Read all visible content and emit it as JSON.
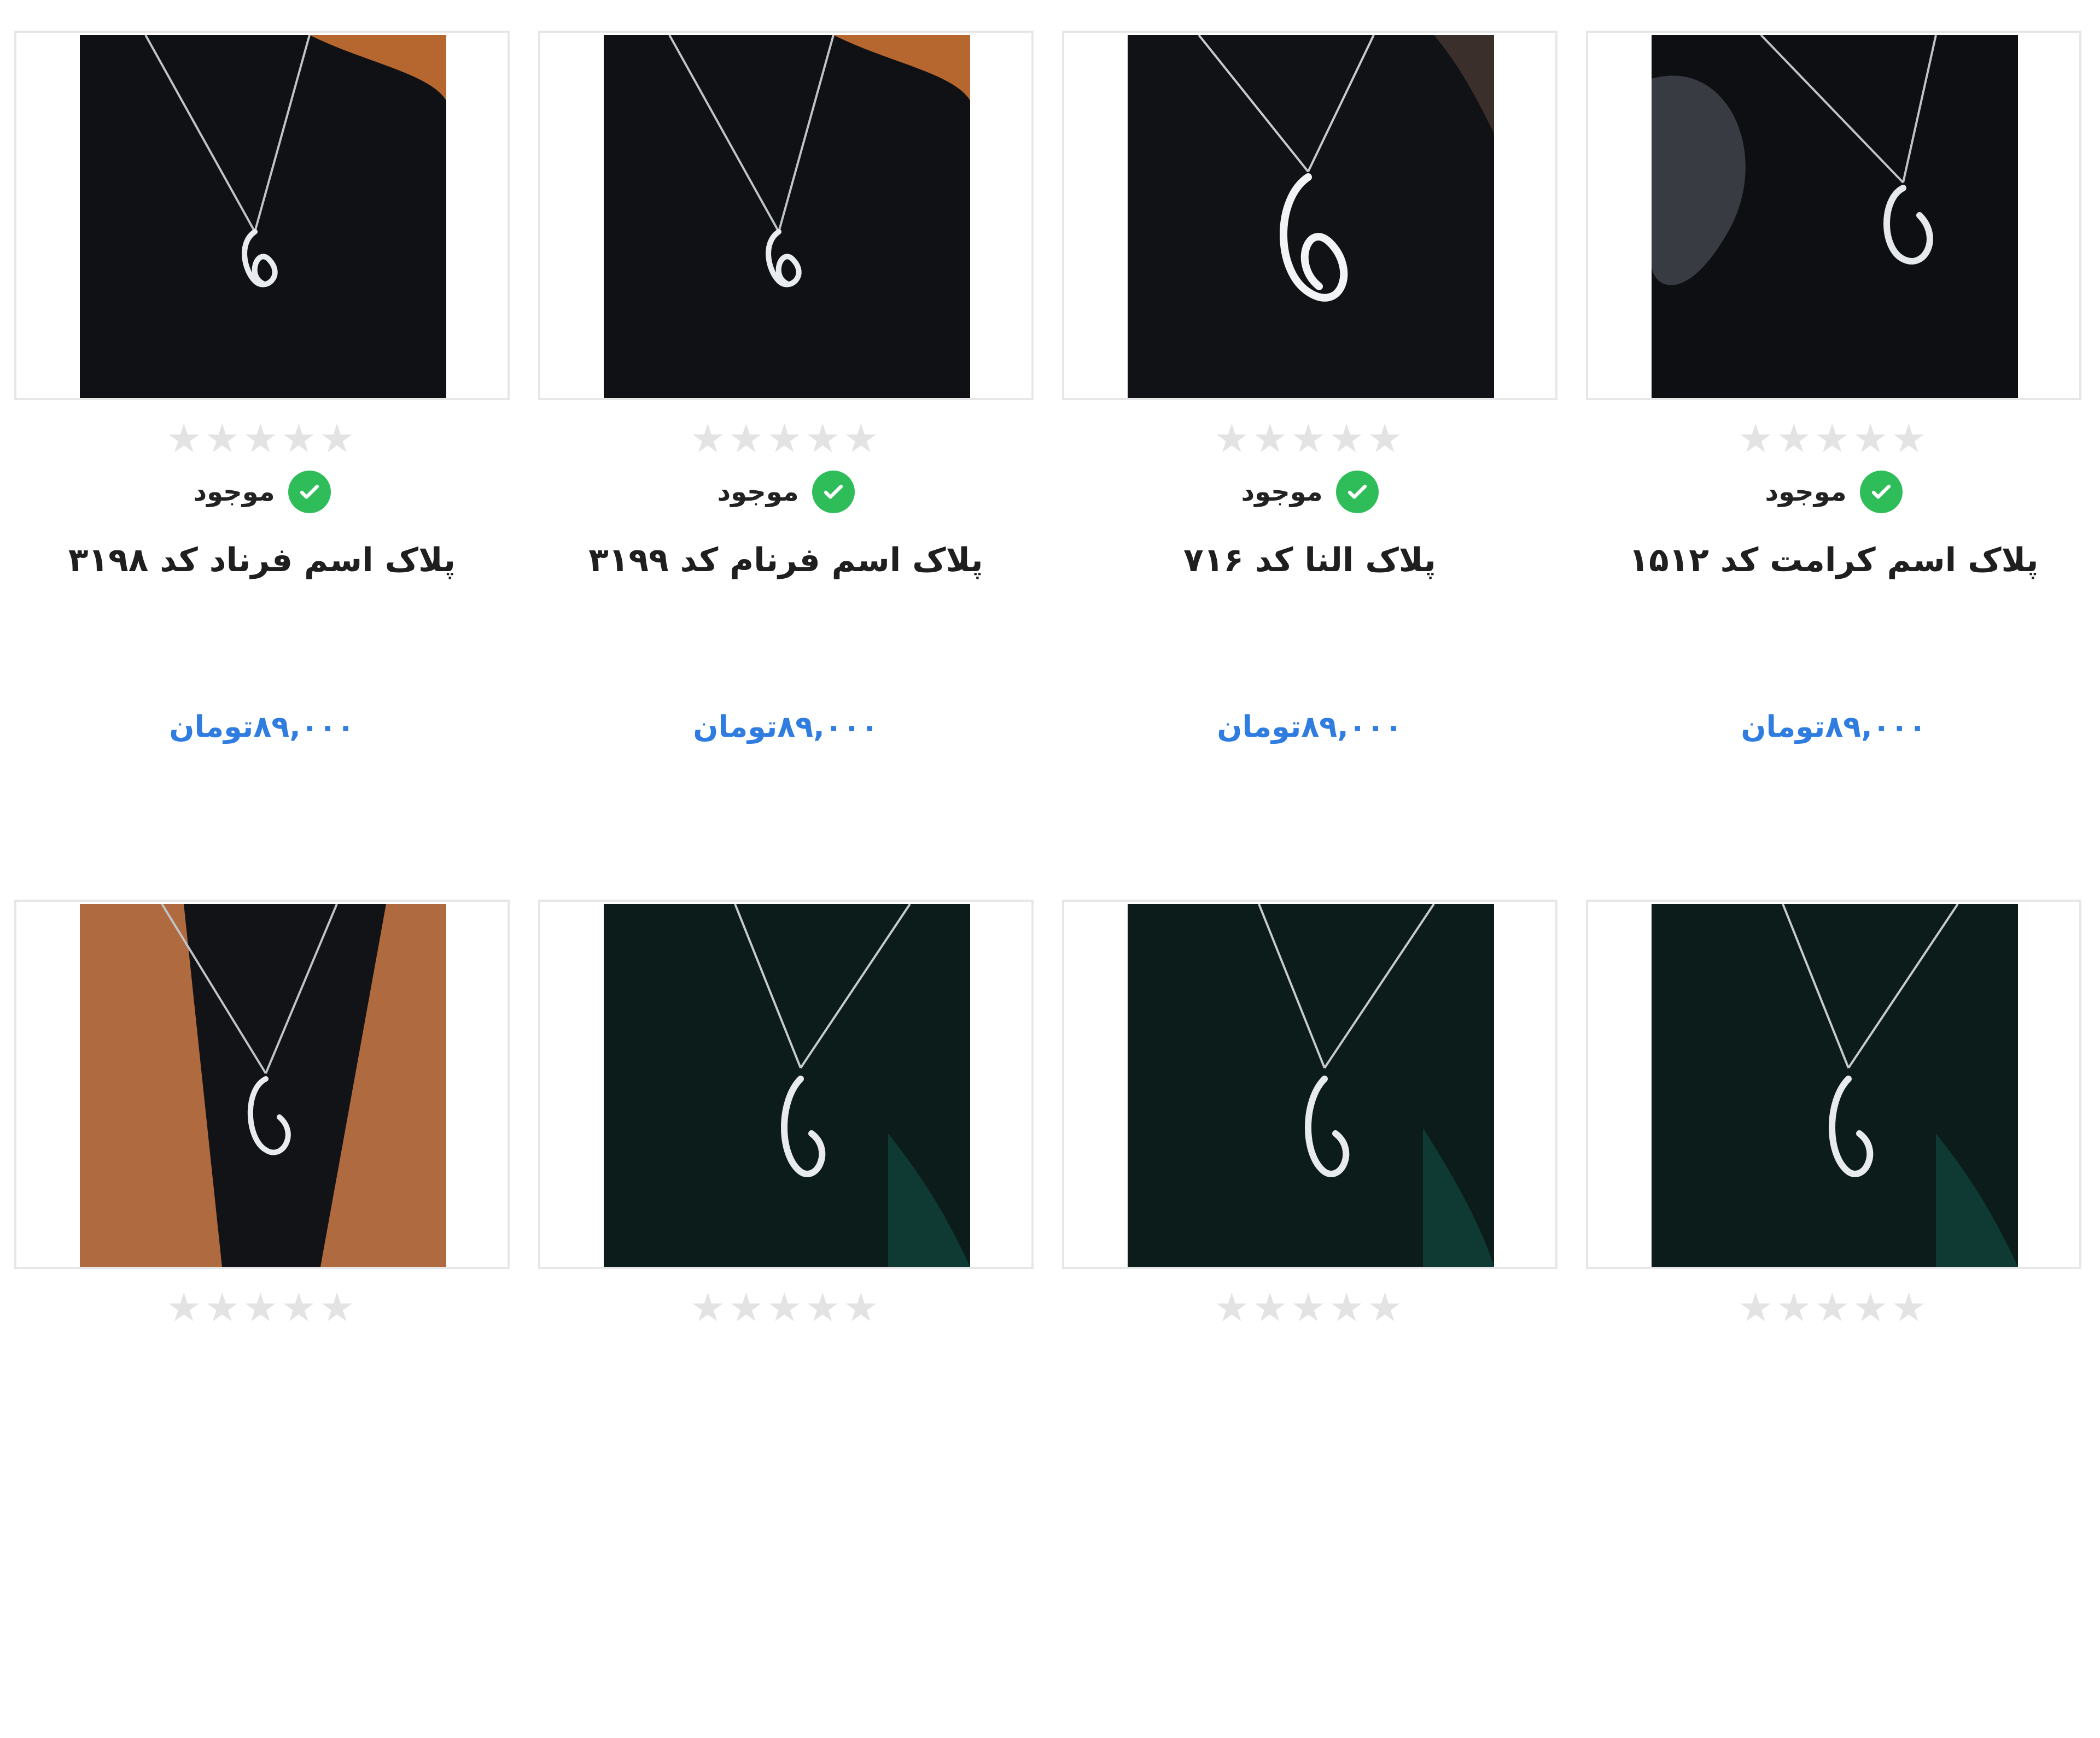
{
  "products": [
    {
      "title": "پلاک اسم فرناد کد ۳۱۹۸",
      "stock": "موجود",
      "price": "۸۹,۰۰۰تومان",
      "bg": "#101114",
      "accent": "#b6672f"
    },
    {
      "title": "پلاک اسم فرنام کد ۳۱۹۹",
      "stock": "موجود",
      "price": "۸۹,۰۰۰تومان",
      "bg": "#101114",
      "accent": "#b6672f"
    },
    {
      "title": "پلاک النا کد ۷۱۶",
      "stock": "موجود",
      "price": "۸۹,۰۰۰تومان",
      "bg": "#111215",
      "accent": "#3a2f2b"
    },
    {
      "title": "پلاک اسم کرامت کد ۱۵۱۲",
      "stock": "موجود",
      "price": "۸۹,۰۰۰تومان",
      "bg": "#0d0f12",
      "accent": "#4b4f56"
    },
    {
      "title": "",
      "stock": "",
      "price": "",
      "bg": "#121316",
      "accent": "#b06a3f"
    },
    {
      "title": "",
      "stock": "",
      "price": "",
      "bg": "#0c1c1b",
      "accent": "#0f3a34"
    },
    {
      "title": "",
      "stock": "",
      "price": "",
      "bg": "#0c1c1b",
      "accent": "#0f3a34"
    },
    {
      "title": "",
      "stock": "",
      "price": "",
      "bg": "#0c1c1b",
      "accent": "#0f3a34"
    }
  ],
  "ui": {
    "check_icon": "check-icon",
    "star_icon": "star-icon"
  }
}
